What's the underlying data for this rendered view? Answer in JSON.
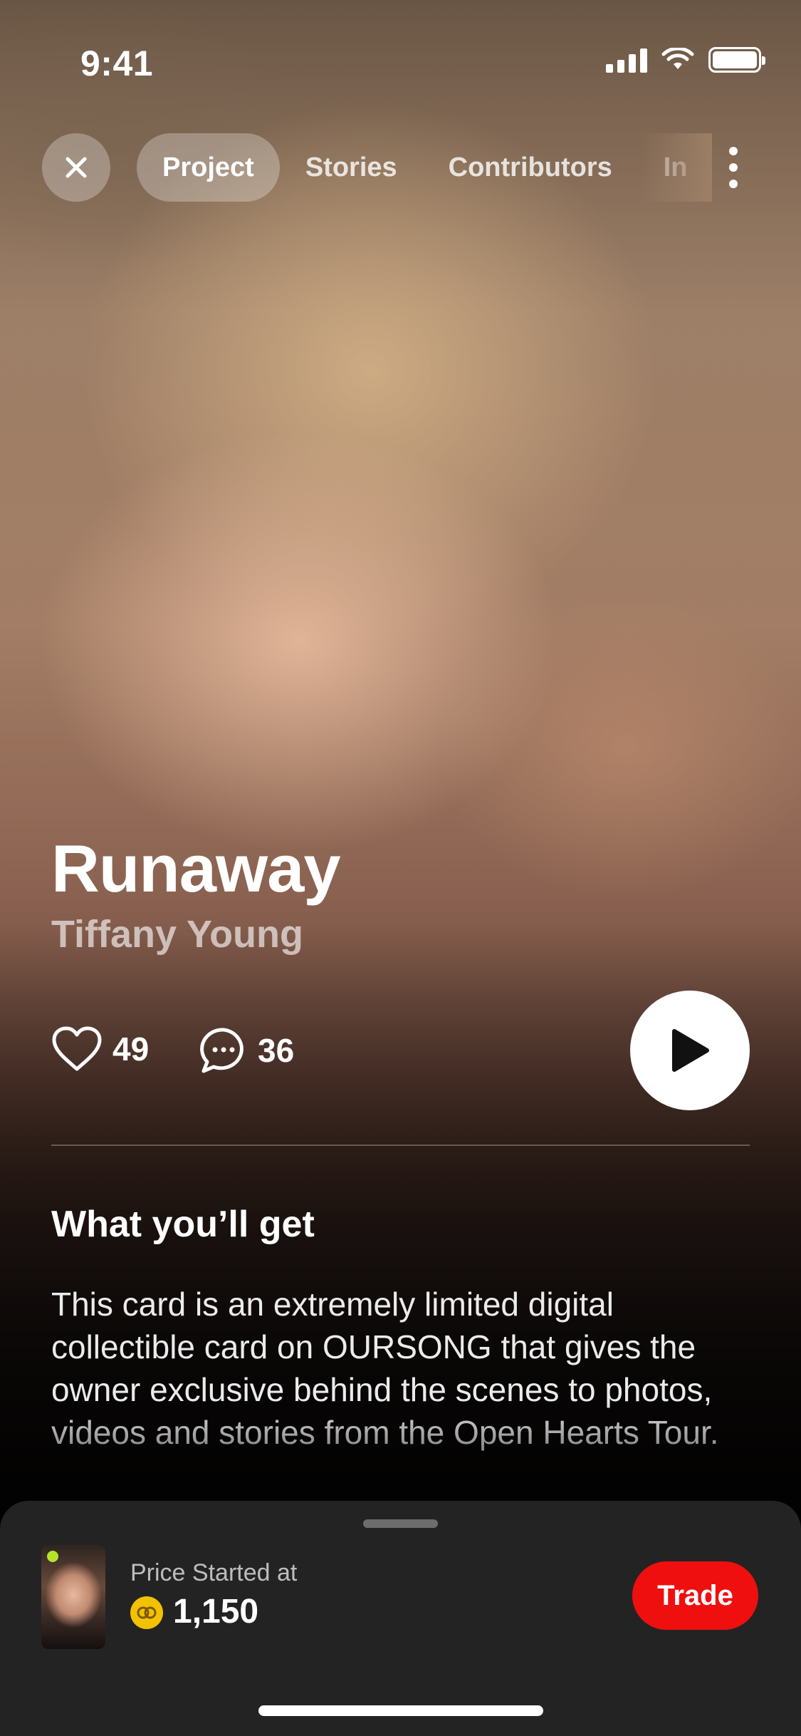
{
  "status_bar": {
    "time": "9:41"
  },
  "nav": {
    "tabs": [
      {
        "label": "Project",
        "active": true
      },
      {
        "label": "Stories",
        "active": false
      },
      {
        "label": "Contributors",
        "active": false
      },
      {
        "label": "In",
        "active": false
      }
    ]
  },
  "song": {
    "title": "Runaway",
    "artist": "Tiffany Young"
  },
  "stats": {
    "likes": "49",
    "comments": "36"
  },
  "details": {
    "section_title": "What you’ll get",
    "description": "This card is an extremely limited digital collectible card on OURSONG that gives the owner exclusive behind the scenes to photos, videos and stories from the Open Hearts Tour."
  },
  "sheet": {
    "price_label": "Price Started at",
    "price_value": "1,150",
    "trade_label": "Trade"
  },
  "colors": {
    "accent": "#ef0f0f",
    "coin": "#f2c200",
    "sheet_bg": "#232323"
  },
  "icons": [
    "close-icon",
    "more-vertical-icon",
    "heart-icon",
    "comment-icon",
    "play-icon",
    "coin-icon",
    "signal-icon",
    "wifi-icon",
    "battery-icon"
  ]
}
